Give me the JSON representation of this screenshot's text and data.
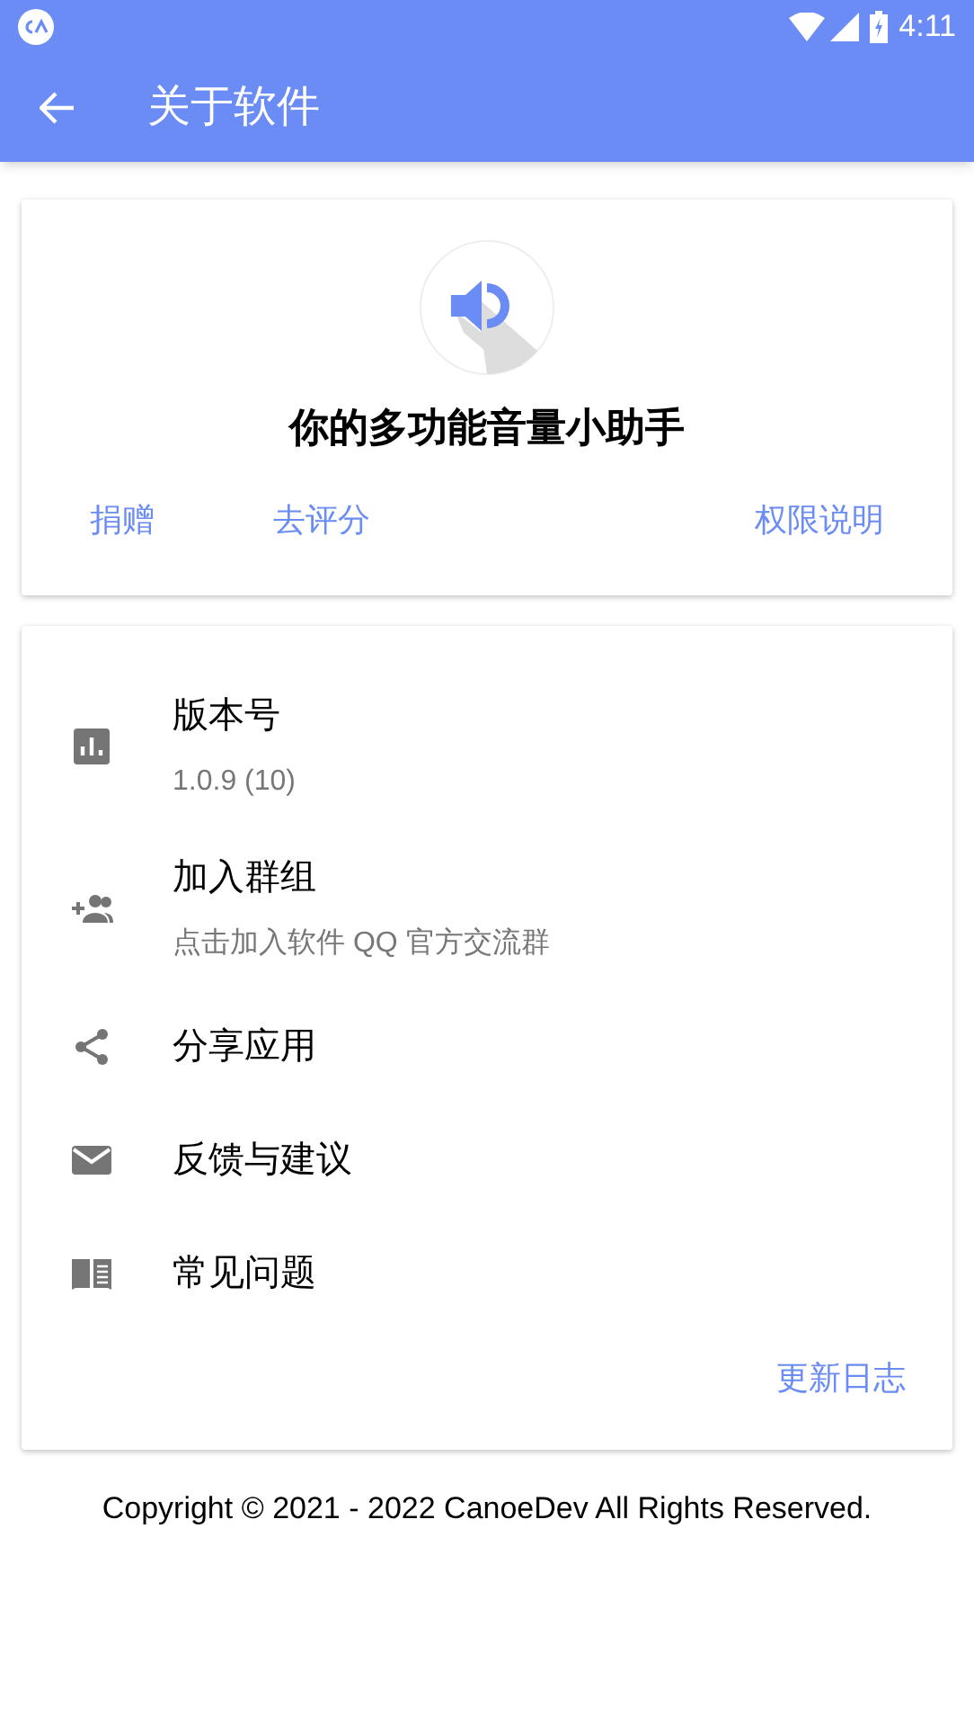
{
  "status_bar": {
    "time": "4:11"
  },
  "app_bar": {
    "title": "关于软件"
  },
  "header_card": {
    "tagline": "你的多功能音量小助手",
    "actions": [
      "捐赠",
      "去评分",
      "权限说明"
    ]
  },
  "items": [
    {
      "kind": "version",
      "title": "版本号",
      "subtitle": "1.0.9 (10)"
    },
    {
      "kind": "group",
      "title": "加入群组",
      "subtitle": "点击加入软件 QQ 官方交流群"
    },
    {
      "kind": "share",
      "title": "分享应用"
    },
    {
      "kind": "mail",
      "title": "反馈与建议"
    },
    {
      "kind": "book",
      "title": "常见问题"
    }
  ],
  "changelog_link": "更新日志",
  "copyright": "Copyright © 2021 - 2022 CanoeDev All Rights Reserved."
}
